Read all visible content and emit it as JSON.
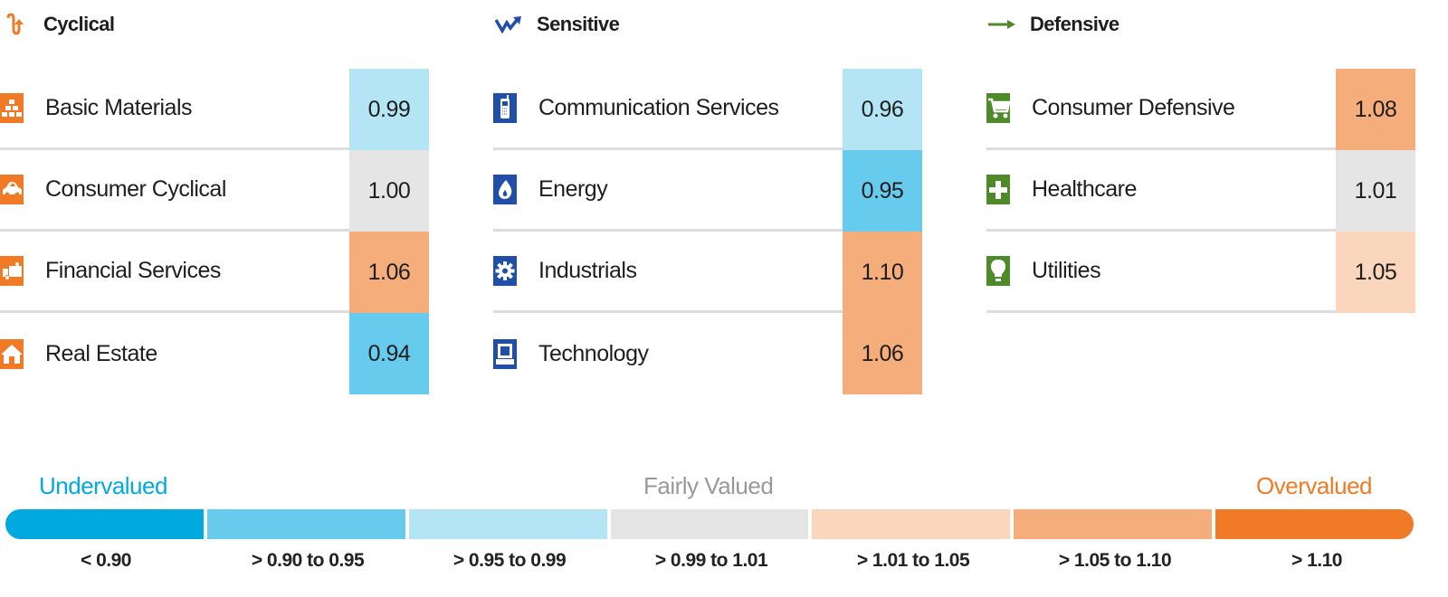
{
  "groups": [
    {
      "title": "Cyclical",
      "icon": "cyclical-arrow-icon",
      "color": "#f07a26",
      "sectors": [
        {
          "name": "Basic Materials",
          "icon": "gold-bars-icon",
          "value": "0.99"
        },
        {
          "name": "Consumer Cyclical",
          "icon": "car-icon",
          "value": "1.00"
        },
        {
          "name": "Financial Services",
          "icon": "bank-truck-icon",
          "value": "1.06"
        },
        {
          "name": "Real Estate",
          "icon": "house-icon",
          "value": "0.94"
        }
      ]
    },
    {
      "title": "Sensitive",
      "icon": "sensitive-zigzag-icon",
      "color": "#1f4fa8",
      "sectors": [
        {
          "name": "Communication Services",
          "icon": "phone-icon",
          "value": "0.96"
        },
        {
          "name": "Energy",
          "icon": "flame-icon",
          "value": "0.95"
        },
        {
          "name": "Industrials",
          "icon": "gear-icon",
          "value": "1.10"
        },
        {
          "name": "Technology",
          "icon": "computer-icon",
          "value": "1.06"
        }
      ]
    },
    {
      "title": "Defensive",
      "icon": "defensive-arrow-icon",
      "color": "#4f8a2a",
      "sectors": [
        {
          "name": "Consumer Defensive",
          "icon": "cart-icon",
          "value": "1.08"
        },
        {
          "name": "Healthcare",
          "icon": "cross-icon",
          "value": "1.01"
        },
        {
          "name": "Utilities",
          "icon": "lightbulb-icon",
          "value": "1.05"
        }
      ]
    }
  ],
  "legend": {
    "undervalued": "Undervalued",
    "fairly_valued": "Fairly Valued",
    "overvalued": "Overvalued",
    "colors": {
      "undervalued": "#00a9e0",
      "fairly_valued": "#999999",
      "overvalued": "#f07a26"
    },
    "ranges": [
      {
        "label": "< 0.90",
        "color": "#00a9e0"
      },
      {
        "label": "> 0.90 to 0.95",
        "color": "#66cbec"
      },
      {
        "label": "> 0.95 to 0.99",
        "color": "#b3e5f5"
      },
      {
        "label": "> 0.99 to 1.01",
        "color": "#e5e5e5"
      },
      {
        "label": "> 1.01 to 1.05",
        "color": "#fad6bd"
      },
      {
        "label": "> 1.05 to 1.10",
        "color": "#f5ad7b"
      },
      {
        "label": "> 1.10",
        "color": "#f07a26"
      }
    ]
  }
}
